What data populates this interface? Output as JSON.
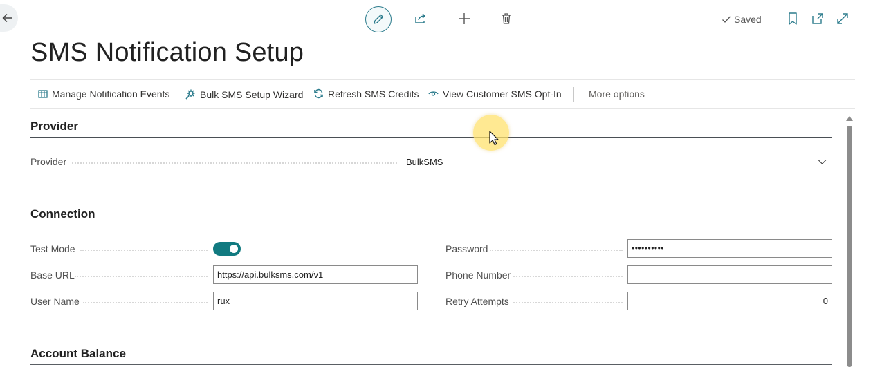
{
  "header": {
    "title": "SMS Notification Setup",
    "status": "Saved",
    "icons": [
      "back-arrow-icon",
      "pencil-icon",
      "share-icon",
      "plus-icon",
      "trash-icon",
      "checkmark-icon",
      "bookmark-icon",
      "open-new-window-icon",
      "expand-icon"
    ]
  },
  "actions": [
    {
      "label": "Manage Notification Events",
      "icon": "table-icon"
    },
    {
      "label": "Bulk SMS Setup Wizard",
      "icon": "gear-wizard-icon"
    },
    {
      "label": "Refresh SMS Credits",
      "icon": "refresh-icon"
    },
    {
      "label": "View Customer SMS Opt-In",
      "icon": "eye-icon"
    },
    {
      "label": "More options"
    }
  ],
  "provider_section": {
    "title": "Provider",
    "provider_label": "Provider",
    "provider_value": "BulkSMS"
  },
  "connection_section": {
    "title": "Connection",
    "test_mode_label": "Test Mode",
    "test_mode_on": true,
    "base_url_label": "Base URL",
    "base_url_value": "https://api.bulksms.com/v1",
    "user_name_label": "User Name",
    "user_name_value": "rux",
    "password_label": "Password",
    "password_value": "••••••••••",
    "phone_number_label": "Phone Number",
    "phone_number_value": "",
    "retry_attempts_label": "Retry Attempts",
    "retry_attempts_value": "0"
  },
  "account_balance_section": {
    "title": "Account Balance"
  },
  "colors": {
    "accent": "#117a80",
    "section_rule": "#4a4f55",
    "icon_teal": "#2b7b8c",
    "cursor_highlight": "#ffe16e"
  }
}
